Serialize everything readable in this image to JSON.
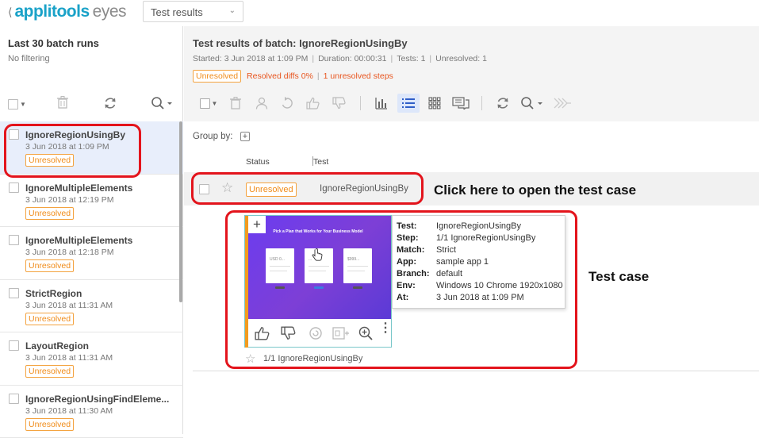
{
  "header": {
    "brand": "applitools",
    "brand_suffix": "eyes",
    "view_select": {
      "value": "Test results"
    }
  },
  "sidebar": {
    "title": "Last 30 batch runs",
    "filter_text": "No filtering",
    "batches": [
      {
        "name": "IgnoreRegionUsingBy",
        "date": "3 Jun 2018 at 1:09 PM",
        "status": "Unresolved",
        "selected": true
      },
      {
        "name": "IgnoreMultipleElements",
        "date": "3 Jun 2018 at 12:19 PM",
        "status": "Unresolved"
      },
      {
        "name": "IgnoreMultipleElements",
        "date": "3 Jun 2018 at 12:18 PM",
        "status": "Unresolved"
      },
      {
        "name": "StrictRegion",
        "date": "3 Jun 2018 at 11:31 AM",
        "status": "Unresolved"
      },
      {
        "name": "LayoutRegion",
        "date": "3 Jun 2018 at 11:31 AM",
        "status": "Unresolved"
      },
      {
        "name": "IgnoreRegionUsingFindEleme...",
        "date": "3 Jun 2018 at 11:30 AM",
        "status": "Unresolved"
      }
    ]
  },
  "main": {
    "title_label": "Test results of batch:",
    "title_value": "IgnoreRegionUsingBy",
    "meta": {
      "started": "Started: 3 Jun 2018 at 1:09 PM",
      "duration": "Duration: 00:00:31",
      "tests": "Tests: 1",
      "unresolved": "Unresolved: 1"
    },
    "status": {
      "badge": "Unresolved",
      "resolved_diffs": "Resolved diffs 0%",
      "unresolved_steps": "1 unresolved steps"
    },
    "group_by_label": "Group by:",
    "columns": {
      "status": "Status",
      "test": "Test"
    },
    "row": {
      "status": "Unresolved",
      "test": "IgnoreRegionUsingBy"
    },
    "thumbnail": {
      "headline": "Pick a Plan that Works for Your Business Model",
      "plans": [
        "USD 0...",
        "...",
        "$999..."
      ],
      "caption": "1/1 IgnoreRegionUsingBy"
    },
    "details": [
      {
        "key": "Test:",
        "value": "IgnoreRegionUsingBy"
      },
      {
        "key": "Step:",
        "value": "1/1 IgnoreRegionUsingBy"
      },
      {
        "key": "Match:",
        "value": "Strict"
      },
      {
        "key": "App:",
        "value": "sample app 1"
      },
      {
        "key": "Branch:",
        "value": "default"
      },
      {
        "key": "Env:",
        "value": "Windows 10 Chrome 1920x1080"
      },
      {
        "key": "At:",
        "value": "3 Jun 2018 at 1:09 PM"
      }
    ]
  },
  "annotations": {
    "open_hint": "Click here to open the test case",
    "test_case": "Test case"
  },
  "colors": {
    "brand": "#1aa2c8",
    "unresolved": "#f08c1a",
    "highlight": "#e3141c",
    "selected_row": "#e8eefb",
    "thumb_purple": "#6b3cf0"
  }
}
